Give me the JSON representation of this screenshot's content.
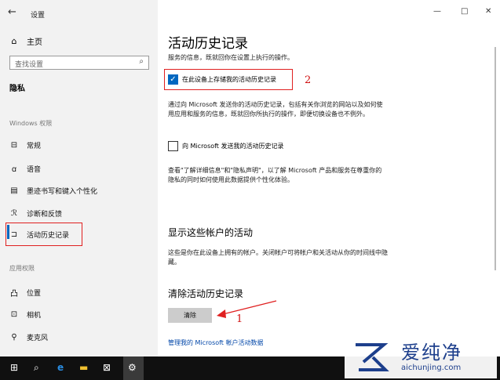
{
  "window": {
    "title": "设置",
    "controls": [
      "—",
      "□",
      "✕"
    ]
  },
  "sidebar": {
    "home": "主页",
    "search_placeholder": "查找设置",
    "section": "隐私",
    "group_windows": "Windows 权限",
    "items": [
      {
        "icon": "lock-icon",
        "glyph": "⊟",
        "label": "常规"
      },
      {
        "icon": "speech-icon",
        "glyph": "ꭤ",
        "label": "语音"
      },
      {
        "icon": "notebook-icon",
        "glyph": "▤",
        "label": "墨迹书写和键入个性化"
      },
      {
        "icon": "feedback-icon",
        "glyph": "ℛ",
        "label": "诊断和反馈"
      },
      {
        "icon": "timeline-icon",
        "glyph": "⊐",
        "label": "活动历史记录"
      }
    ],
    "group_apps": "应用权限",
    "app_items": [
      {
        "icon": "location-icon",
        "glyph": "凸",
        "label": "位置"
      },
      {
        "icon": "camera-icon",
        "glyph": "⊡",
        "label": "相机"
      },
      {
        "icon": "microphone-icon",
        "glyph": "⚲",
        "label": "麦克风"
      }
    ]
  },
  "main": {
    "title": "活动历史记录",
    "subtitle": "服务的信息，既就回你在设置上执行的操作。",
    "checkbox1": {
      "label": "在此设备上存储我的活动历史记录",
      "checked": true
    },
    "para1": "通过向 Microsoft 发送你的活动历史记录，包括有关你浏览的网站以及如何使用应用和服务的信息，既就回你所执行的操作，即便切换设备也不例外。",
    "checkbox2": {
      "label": "向 Microsoft 发送我的活动历史记录",
      "checked": false
    },
    "para2": "查看\"了解详细信息\"和\"隐私声明\"，以了解 Microsoft 产品和服务在尊重你的隐私的同时如何使用此数据提供个性化体验。",
    "accounts_heading": "显示这些帐户的活动",
    "accounts_text": "这些是你在此设备上拥有的帐户。关闭帐户可将帐户和关活动从你的时间线中隐藏。",
    "clear_heading": "清除活动历史记录",
    "clear_button": "清除",
    "manage_link": "管理我的 Microsoft 帐户活动数据"
  },
  "annotations": {
    "one": "1",
    "two": "2"
  },
  "watermark": {
    "cn": "爱纯净",
    "en": "aichunjing.com"
  },
  "colors": {
    "accent": "#0067c0",
    "annotation": "#e02020",
    "taskbar": "#101010"
  }
}
